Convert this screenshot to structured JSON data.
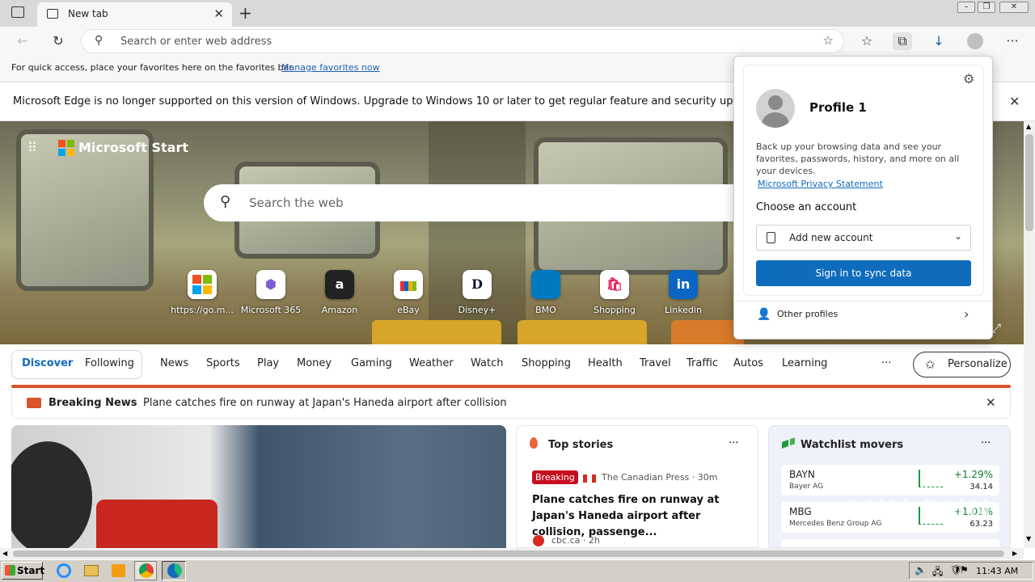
{
  "tab": {
    "title": "New tab"
  },
  "address_bar": {
    "placeholder": "Search or enter web address"
  },
  "favorites_bar": {
    "text": "For quick access, place your favorites here on the favorites bar.",
    "link": "Manage favorites now"
  },
  "notice": {
    "text": "Microsoft Edge is no longer supported on this version of Windows. Upgrade to Windows 10 or later to get regular feature and security updates from M"
  },
  "start": {
    "brand": "Microsoft Start",
    "search_placeholder": "Search the web",
    "tiles": [
      {
        "label": "https://go.m...",
        "icon": "windows-icon"
      },
      {
        "label": "Microsoft 365",
        "icon": "m365-icon"
      },
      {
        "label": "Amazon",
        "icon": "amazon-icon",
        "glyph": "a"
      },
      {
        "label": "eBay",
        "icon": "ebay-icon"
      },
      {
        "label": "Disney+",
        "icon": "disney-icon",
        "glyph": "D"
      },
      {
        "label": "BMO",
        "icon": "bmo-icon"
      },
      {
        "label": "Shopping",
        "icon": "shopping-bag-icon"
      },
      {
        "label": "Linkedin",
        "icon": "linkedin-icon",
        "glyph": "in"
      }
    ]
  },
  "nav": {
    "discover": "Discover",
    "following": "Following",
    "items": [
      "News",
      "Sports",
      "Play",
      "Money",
      "Gaming",
      "Weather",
      "Watch",
      "Shopping",
      "Health",
      "Travel",
      "Traffic",
      "Autos",
      "Learning"
    ],
    "more": "···",
    "personalize": "Personalize"
  },
  "breaking": {
    "label": "Breaking News",
    "text": "Plane catches fire on runway at Japan's Haneda airport after collision"
  },
  "top_stories": {
    "title": "Top stories",
    "badge": "Breaking",
    "source": "The Canadian Press · 30m",
    "headline": "Plane catches fire on runway at Japan's Haneda airport after collision, passenge...",
    "source2": "cbc.ca · 2h"
  },
  "watchlist": {
    "title": "Watchlist movers",
    "rows": [
      {
        "ticker": "BAYN",
        "name": "Bayer AG",
        "change": "+1.29%",
        "price": "34.14"
      },
      {
        "ticker": "MBG",
        "name": "Mercedes Benz Group AG",
        "change": "+1.01%",
        "price": "63.23"
      }
    ]
  },
  "profile": {
    "name": "Profile 1",
    "desc": "Back up your browsing data and see your favorites, passwords, history, and more on all your devices.",
    "privacy": "Microsoft Privacy Statement",
    "choose": "Choose an account",
    "add": "Add new account",
    "signin": "Sign in to sync data",
    "other": "Other profiles"
  },
  "taskbar": {
    "start": "Start",
    "clock": "11:43 AM"
  },
  "watermark": "ANY RUN"
}
